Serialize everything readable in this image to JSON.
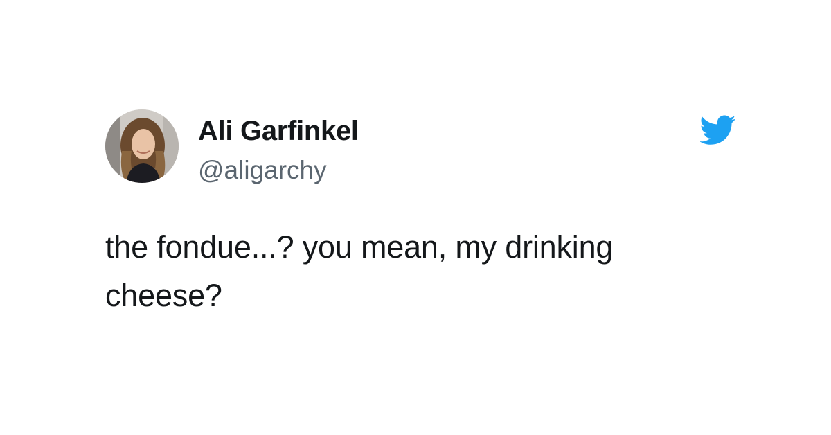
{
  "tweet": {
    "author": {
      "display_name": "Ali Garfinkel",
      "handle": "@aligarchy",
      "avatar_icon": "profile-photo"
    },
    "brand": {
      "icon": "twitter-bird-icon",
      "color": "#1da1f2"
    },
    "text_lines": [
      "the fondue...? you mean, my drinking",
      "cheese?"
    ]
  }
}
